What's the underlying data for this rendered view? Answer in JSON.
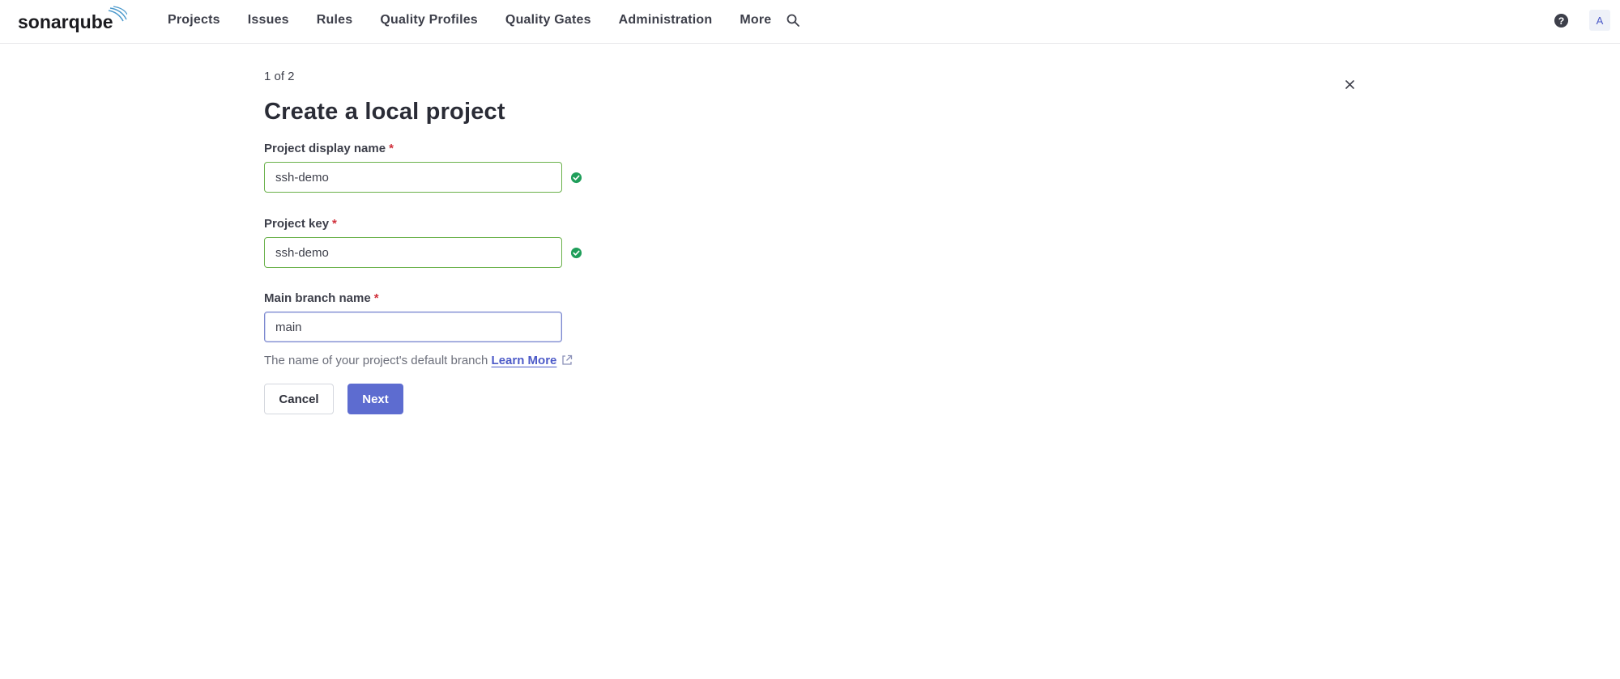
{
  "app": {
    "logo_text": "sonarqube"
  },
  "nav": {
    "items": [
      {
        "label": "Projects"
      },
      {
        "label": "Issues"
      },
      {
        "label": "Rules"
      },
      {
        "label": "Quality Profiles"
      },
      {
        "label": "Quality Gates"
      },
      {
        "label": "Administration"
      },
      {
        "label": "More"
      }
    ],
    "avatar_initial": "A"
  },
  "wizard": {
    "step": "1 of 2",
    "title": "Create a local project"
  },
  "form": {
    "display_name": {
      "label": "Project display name",
      "required_marker": "*",
      "value": "ssh-demo"
    },
    "project_key": {
      "label": "Project key",
      "required_marker": "*",
      "value": "ssh-demo"
    },
    "main_branch": {
      "label": "Main branch name",
      "required_marker": "*",
      "value": "main",
      "helper_text": "The name of your project's default branch",
      "learn_more": "Learn More"
    },
    "cancel_label": "Cancel",
    "next_label": "Next"
  },
  "colors": {
    "accent": "#5d6cd0",
    "valid": "#1f9e5a",
    "required": "#d02f3a"
  }
}
